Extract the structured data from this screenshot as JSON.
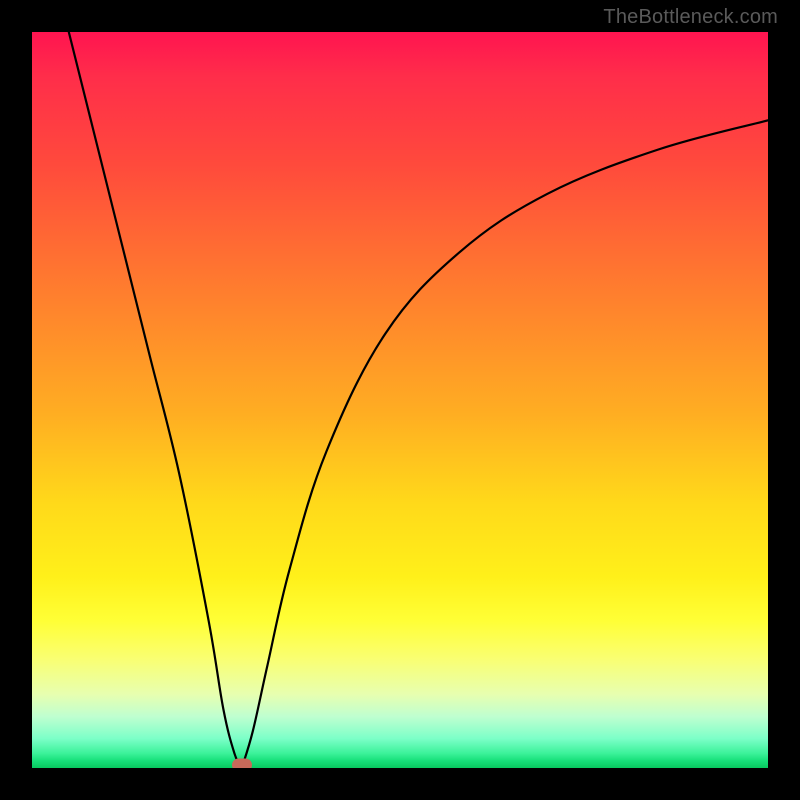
{
  "attribution": "TheBottleneck.com",
  "chart_data": {
    "type": "line",
    "title": "",
    "xlabel": "",
    "ylabel": "",
    "xlim": [
      0,
      100
    ],
    "ylim": [
      0,
      100
    ],
    "series": [
      {
        "name": "curve-left",
        "x": [
          5,
          8,
          12,
          16,
          20,
          24,
          26,
          27.5,
          28.5
        ],
        "y": [
          100,
          88,
          72,
          56,
          40,
          20,
          8,
          2,
          0
        ]
      },
      {
        "name": "curve-right",
        "x": [
          28.5,
          30,
          32,
          35,
          40,
          48,
          58,
          70,
          85,
          100
        ],
        "y": [
          0,
          5,
          14,
          27,
          43,
          59,
          70,
          78,
          84,
          88
        ]
      }
    ],
    "marker": {
      "x": 28.5,
      "y": 0
    },
    "grid": false,
    "legend": false
  },
  "colors": {
    "curve": "#000000",
    "marker": "#c76a5a",
    "frame": "#000000"
  }
}
